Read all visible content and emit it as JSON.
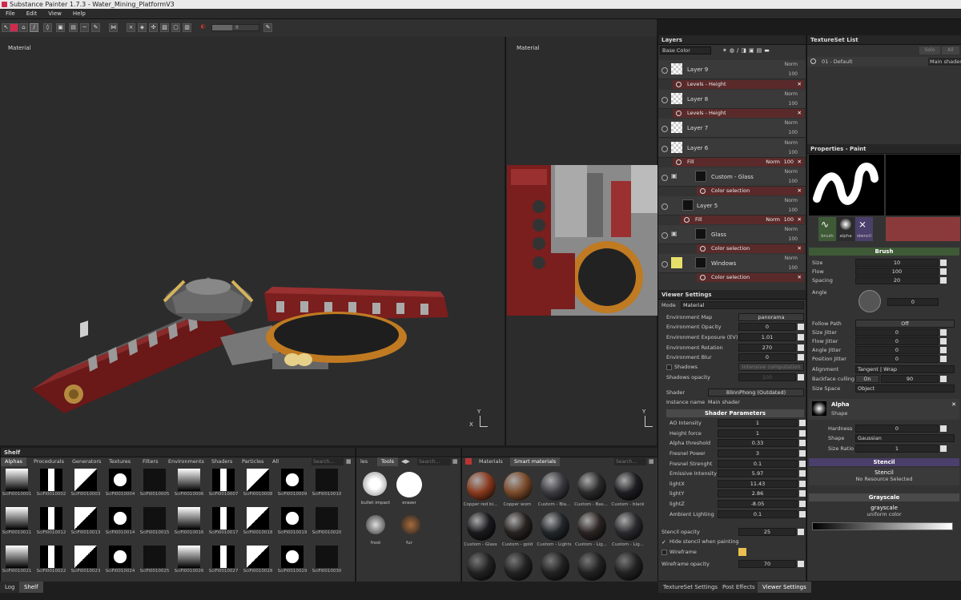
{
  "window": {
    "title": "Substance Painter 1.7.3 - Water_Mining_PlatformV3"
  },
  "menu": [
    "File",
    "Edit",
    "View",
    "Help"
  ],
  "toolbar": {
    "size_value": "8"
  },
  "viewport_left": {
    "label": "Material"
  },
  "viewport_right": {
    "label": "Material"
  },
  "layers": {
    "title": "Layers",
    "channel": "Base Color",
    "rows": [
      {
        "name": "Layer 9",
        "blend": "Norm",
        "opacity": "100",
        "thumb": "checker"
      },
      {
        "name": "Layer 8",
        "blend": "Norm",
        "opacity": "100",
        "thumb": "checker"
      },
      {
        "name": "Layer 7",
        "blend": "Norm",
        "opacity": "100",
        "thumb": "checker"
      },
      {
        "name": "Layer 6",
        "blend": "Norm",
        "opacity": "100",
        "thumb": "checker"
      },
      {
        "name": "Custom - Glass",
        "blend": "Norm",
        "opacity": "100",
        "thumb": "dark"
      },
      {
        "name": "Layer 5",
        "blend": "Norm",
        "opacity": "100",
        "thumb": "dark"
      },
      {
        "name": "Glass",
        "blend": "Norm",
        "opacity": "100",
        "thumb": "dark"
      },
      {
        "name": "Windows",
        "blend": "Norm",
        "opacity": "100",
        "thumb": "yellow"
      }
    ],
    "effects": [
      {
        "name": "Levels - Height"
      },
      {
        "name": "Levels - Height"
      },
      {
        "name": "Fill",
        "blend": "Norm",
        "opacity": "100"
      },
      {
        "name": "Color selection"
      },
      {
        "name": "Fill",
        "blend": "Norm",
        "opacity": "100"
      },
      {
        "name": "Color selection"
      },
      {
        "name": "Color selection"
      }
    ]
  },
  "textureset": {
    "title": "TextureSet List",
    "btn_solo": "Solo",
    "btn_all": "All",
    "item": "01 - Default",
    "shader": "Main shader"
  },
  "viewer": {
    "title": "Viewer Settings",
    "mode_label": "Mode",
    "mode_value": "Material",
    "env_map_label": "Environment Map",
    "env_map_value": "panorama",
    "rows": [
      {
        "label": "Environment Opacity",
        "value": "0"
      },
      {
        "label": "Environment Exposure (EV)",
        "value": "1.01"
      },
      {
        "label": "Environment Rotation",
        "value": "270"
      },
      {
        "label": "Environment Blur",
        "value": "0"
      }
    ],
    "shadows_label": "Shadows",
    "shadows_value": "Intensive computation",
    "shadows_opacity_label": "Shadows opacity",
    "shadows_opacity_value": "100",
    "shader_label": "Shader",
    "shader_value": "BlinnPhong (Outdated)",
    "instance_label": "Instance name",
    "instance_value": "Main shader",
    "shader_params_title": "Shader Parameters",
    "params": [
      {
        "label": "AO Intensity",
        "value": "1"
      },
      {
        "label": "Height force",
        "value": "1"
      },
      {
        "label": "Alpha threshold",
        "value": "0.33"
      },
      {
        "label": "Fresnel Power",
        "value": "3"
      },
      {
        "label": "Fresnel Strenght",
        "value": "0.1"
      },
      {
        "label": "Emissive Intensity",
        "value": "5.97"
      },
      {
        "label": "lightX",
        "value": "11.43"
      },
      {
        "label": "lightY",
        "value": "2.86"
      },
      {
        "label": "lightZ",
        "value": "-8.05"
      },
      {
        "label": "Ambient Lighting",
        "value": "0.1"
      }
    ],
    "stencil_opacity_label": "Stencil opacity",
    "stencil_opacity_value": "25",
    "hide_stencil_label": "Hide stencil when painting",
    "wireframe_label": "Wireframe",
    "wireframe_opacity_label": "Wireframe opacity",
    "wireframe_opacity_value": "70"
  },
  "properties": {
    "title": "Properties - Paint",
    "slots": [
      "brush",
      "alpha",
      "stencil"
    ],
    "brush_title": "Brush",
    "brush_rows": [
      {
        "label": "Size",
        "value": "10"
      },
      {
        "label": "Flow",
        "value": "100"
      },
      {
        "label": "Spacing",
        "value": "20"
      }
    ],
    "angle_label": "Angle",
    "angle_value": "0",
    "follow_path_label": "Follow Path",
    "follow_path_value": "Off",
    "jitter_rows": [
      {
        "label": "Size Jitter",
        "value": "0"
      },
      {
        "label": "Flow Jitter",
        "value": "0"
      },
      {
        "label": "Angle Jitter",
        "value": "0"
      },
      {
        "label": "Position Jitter",
        "value": "0"
      }
    ],
    "alignment_label": "Alignment",
    "alignment_value": "Tangent | Wrap",
    "backface_label": "Backface culling",
    "backface_on": "On",
    "backface_value": "90",
    "size_space_label": "Size Space",
    "size_space_value": "Object",
    "alpha_title": "Alpha",
    "alpha_sub": "Shape",
    "hardness_label": "Hardness",
    "hardness_value": "0",
    "shape_label": "Shape",
    "shape_value": "Gaussian",
    "size_ratio_label": "Size Ratio",
    "size_ratio_value": "1",
    "stencil_title": "Stencil",
    "stencil_name": "Stencil",
    "stencil_sub": "No Resource Selected",
    "grayscale_title": "Grayscale",
    "grayscale_name": "grayscale",
    "grayscale_sub": "uniform color"
  },
  "shelf": {
    "title": "Shelf",
    "tabs": [
      "Alphas",
      "Procedurals",
      "Generators",
      "Textures",
      "Filters",
      "Environments",
      "Shaders",
      "Particles",
      "All"
    ],
    "search_placeholder": "Search...",
    "items": [
      "SciFi0010001",
      "SciFi0010002",
      "SciFi0010003",
      "SciFi0010004",
      "SciFi0010005",
      "SciFi0010006",
      "SciFi0010007",
      "SciFi0010008",
      "SciFi0010009",
      "SciFi0010010",
      "SciFi0010011",
      "SciFi0010012",
      "SciFi0010013",
      "SciFi0010014",
      "SciFi0010015",
      "SciFi0010016",
      "SciFi0010017",
      "SciFi0010018",
      "SciFi0010019",
      "SciFi0010020",
      "SciFi0010021",
      "SciFi0010022",
      "SciFi0010023",
      "SciFi0010024",
      "SciFi0010025",
      "SciFi0010026",
      "SciFi0010027",
      "SciFi0010028",
      "SciFi0010029",
      "SciFi0010030"
    ]
  },
  "tools": {
    "tab_partial": "les",
    "tab": "Tools",
    "search_placeholder": "Search...",
    "items": [
      "bullet impact",
      "eraser",
      "frost",
      "fur"
    ]
  },
  "materials": {
    "tabs": [
      "Materials",
      "Smart materials"
    ],
    "search_placeholder": "Search...",
    "items": [
      "Copper red bl...",
      "Copper worn",
      "Custom - Bla...",
      "Custom - Bas...",
      "Custom - black",
      "Custom - Glass",
      "Custom - gold",
      "Custom - Lights",
      "Custom - Lig...",
      "Custom - Lig..."
    ]
  },
  "bottom_tabs": {
    "left": [
      "Log",
      "Shelf"
    ],
    "right": [
      "TextureSet Settings",
      "Post Effects",
      "Viewer Settings"
    ]
  },
  "colors": {
    "accent_red": "#5a2a2a",
    "section_green": "#3f5a36",
    "section_purple": "#4b3f6b"
  }
}
